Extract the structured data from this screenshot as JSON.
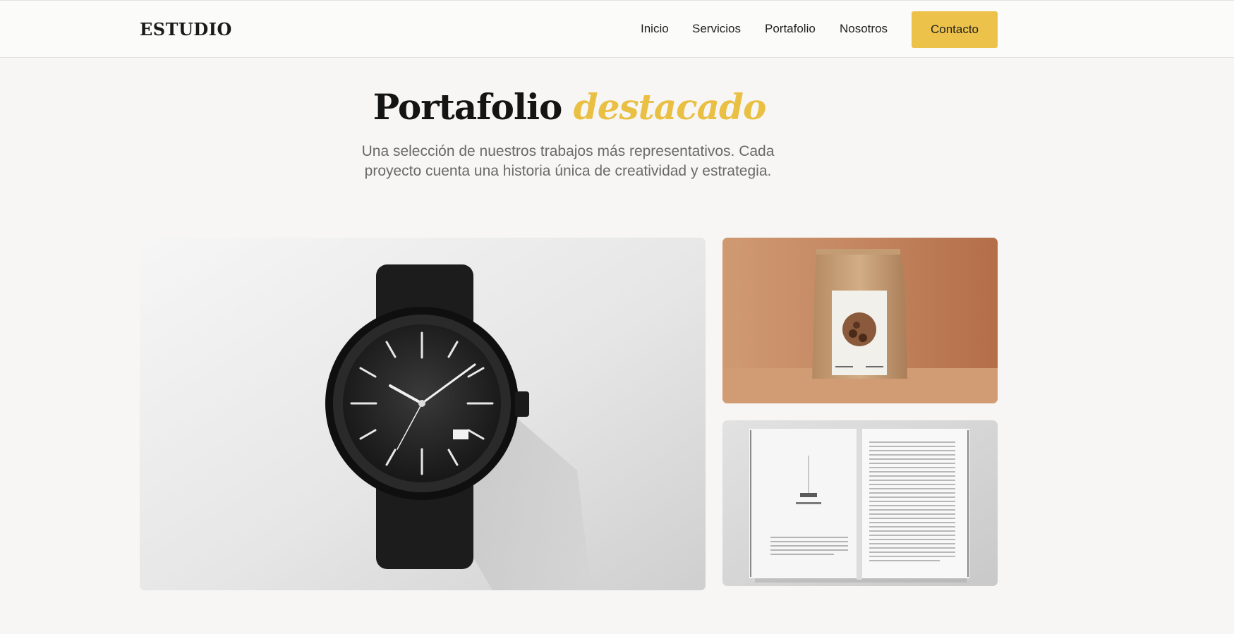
{
  "brand": {
    "logo": "ESTUDIO"
  },
  "nav": {
    "links": [
      "Inicio",
      "Servicios",
      "Portafolio",
      "Nosotros"
    ],
    "cta": "Contacto"
  },
  "hero": {
    "title_main": "Portafolio",
    "title_accent": "destacado",
    "subtitle": "Una selección de nuestros trabajos más representativos. Cada proyecto cuenta una historia única de creatividad y estrategia."
  },
  "gallery": {
    "items": [
      {
        "name": "watch",
        "alt": "Reloj negro"
      },
      {
        "name": "coffee-bag",
        "alt": "Bolsa de café"
      },
      {
        "name": "book",
        "alt": "Libro abierto"
      }
    ]
  },
  "colors": {
    "accent": "#ecc24a",
    "background": "#f7f6f4",
    "text": "#141414",
    "muted": "#6b6966"
  }
}
